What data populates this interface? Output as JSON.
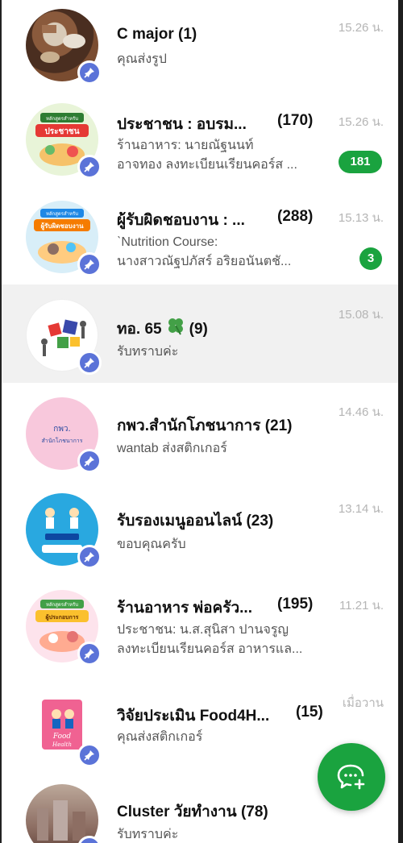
{
  "chats": [
    {
      "name": "C major",
      "count": "(1)",
      "time": "15.26 น.",
      "preview": [
        "คุณส่งรูป"
      ],
      "icon": "pin-icon"
    },
    {
      "name": "ประชาชน : อบรม...",
      "count": "(170)",
      "time": "15.26 น.",
      "preview": [
        "ร้านอาหาร: นายณัฐนนท์",
        "อาจทอง  ลงทะเบียนเรียนคอร์ส ..."
      ],
      "badge": "181",
      "avatar_text": [
        "หลักสูตรสำหรับ",
        "ประชาชน"
      ]
    },
    {
      "name": "ผู้รับผิดชอบงาน : ...",
      "count": "(288)",
      "time": "15.13 น.",
      "preview": [
        "ˋNutrition Course:",
        "นางสาวณัฐปภัสร์  อริยอนันตชั..."
      ],
      "badge": "3",
      "avatar_text": [
        "หลักสูตรสำหรับ",
        "ผู้รับผิดชอบงาน"
      ]
    },
    {
      "name": "ทอ. 65",
      "count": "(9)",
      "time": "15.08 น.",
      "preview": [
        "รับทราบค่ะ"
      ],
      "emoji": "four-leaf-clover-icon"
    },
    {
      "name": "กพว.สำนักโภชนาการ",
      "count": "(21)",
      "time": "14.46 น.",
      "preview": [
        "wantab ส่งสติกเกอร์"
      ],
      "avatar_text": [
        "กพว.",
        "สำนักโภชนาการ"
      ]
    },
    {
      "name": "รับรองเมนูออนไลน์",
      "count": "(23)",
      "time": "13.14 น.",
      "preview": [
        "ขอบคุณครับ"
      ]
    },
    {
      "name": "ร้านอาหาร พ่อครัว...",
      "count": "(195)",
      "time": "11.21 น.",
      "preview": [
        "ประชาชน: น.ส.สุนิสา  ปานจรูญ",
        "ลงทะเบียนเรียนคอร์ส อาหารแล..."
      ],
      "avatar_text": [
        "หลักสูตรสำหรับ",
        "ผู้ประกอบการ"
      ]
    },
    {
      "name": "วิจัยประเมิน Food4H...",
      "count": "(15)",
      "time": "เมื่อวาน",
      "preview": [
        "คุณส่งสติกเกอร์"
      ],
      "avatar_text": [
        "Food",
        "Health"
      ]
    },
    {
      "name": "Cluster วัยทำงาน",
      "count": "(78)",
      "time": "",
      "preview": [
        "รับทราบค่ะ"
      ]
    }
  ],
  "fab": {
    "icon": "new-chat-icon"
  },
  "colors": {
    "accent_green": "#1aa33f",
    "pin_blue": "#5b73d8",
    "selected_row": "#f1f1f1"
  }
}
